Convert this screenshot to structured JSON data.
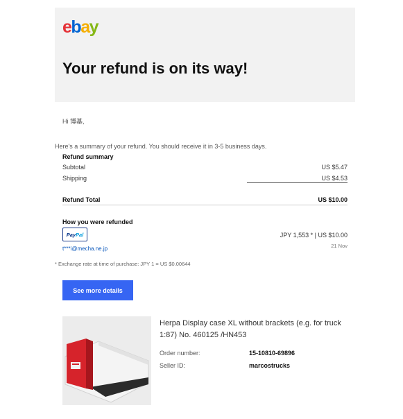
{
  "header": {
    "logo": {
      "e": "e",
      "b": "b",
      "a": "a",
      "y": "y"
    },
    "headline": "Your refund is on its way!"
  },
  "greeting": "Hi 博基,",
  "summary_intro": "Here's a summary of your refund. You should receive it in 3-5 business days.",
  "refund_summary": {
    "title": "Refund summary",
    "rows": [
      {
        "label": "Subtotal",
        "value": "US $5.47"
      },
      {
        "label": "Shipping",
        "value": "US $4.53"
      }
    ],
    "total_label": "Refund Total",
    "total_value": "US $10.00"
  },
  "refund_method": {
    "title": "How you were refunded",
    "paypal_logo": {
      "pay": "Pay",
      "pal": "Pal"
    },
    "email": "t***i@mecha.ne.jp",
    "amount": "JPY 1,553 * | US $10.00",
    "date": "21 Nov"
  },
  "footnote": "* Exchange rate at time of purchase: JPY 1 = US $0.00644",
  "see_more_button": "See more details",
  "item": {
    "title": "Herpa Display case XL without brackets (e.g. for truck 1:87) No. 460125 /HN453",
    "order_number_label": "Order number:",
    "order_number": "15-10810-69896",
    "seller_label": "Seller ID:",
    "seller_id": "marcostrucks"
  },
  "colors": {
    "ebay_red": "#e53238",
    "ebay_blue": "#0064d2",
    "ebay_yellow": "#f5af02",
    "ebay_green": "#86b817",
    "button_blue": "#3665f3",
    "link_blue": "#0654ba"
  }
}
